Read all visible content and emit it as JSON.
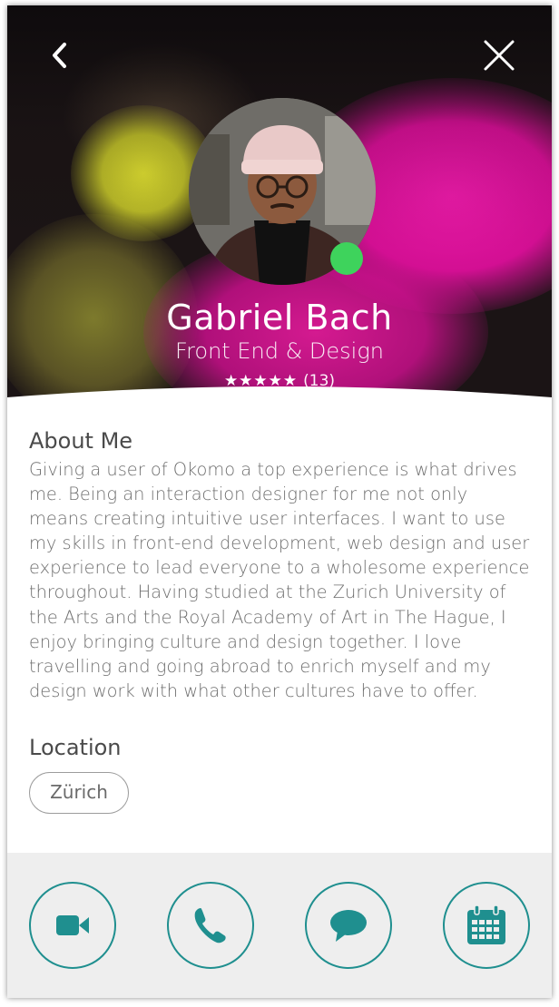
{
  "header": {
    "back_icon": "chevron-left-icon",
    "close_icon": "close-icon"
  },
  "profile": {
    "name": "Gabriel Bach",
    "role": "Front End & Design",
    "stars": "★★★★★",
    "rating_count": "(13)",
    "status": "online",
    "status_color": "#3ed35c"
  },
  "about": {
    "title": "About Me",
    "text": "Giving a user of Okomo a top experience is what drives me. Being an interaction designer for me not only means creating intuitive user interfaces. I want to use my skills in front-end development, web design and user experience to lead everyone to a wholesome experience throughout. Having studied at the Zurich University of the Arts and the Royal Academy of Art in The Hague, I enjoy bringing culture and design together. I love travelling and going abroad to enrich myself and my design work with what other cultures have to offer."
  },
  "location": {
    "title": "Location",
    "value": "Zürich"
  },
  "actions": [
    {
      "icon": "video-camera-icon"
    },
    {
      "icon": "phone-icon"
    },
    {
      "icon": "chat-bubble-icon"
    },
    {
      "icon": "calendar-icon"
    }
  ],
  "colors": {
    "accent": "#1f8f8f",
    "footer_bg": "#eeeeee",
    "text": "#6e6e6e"
  }
}
